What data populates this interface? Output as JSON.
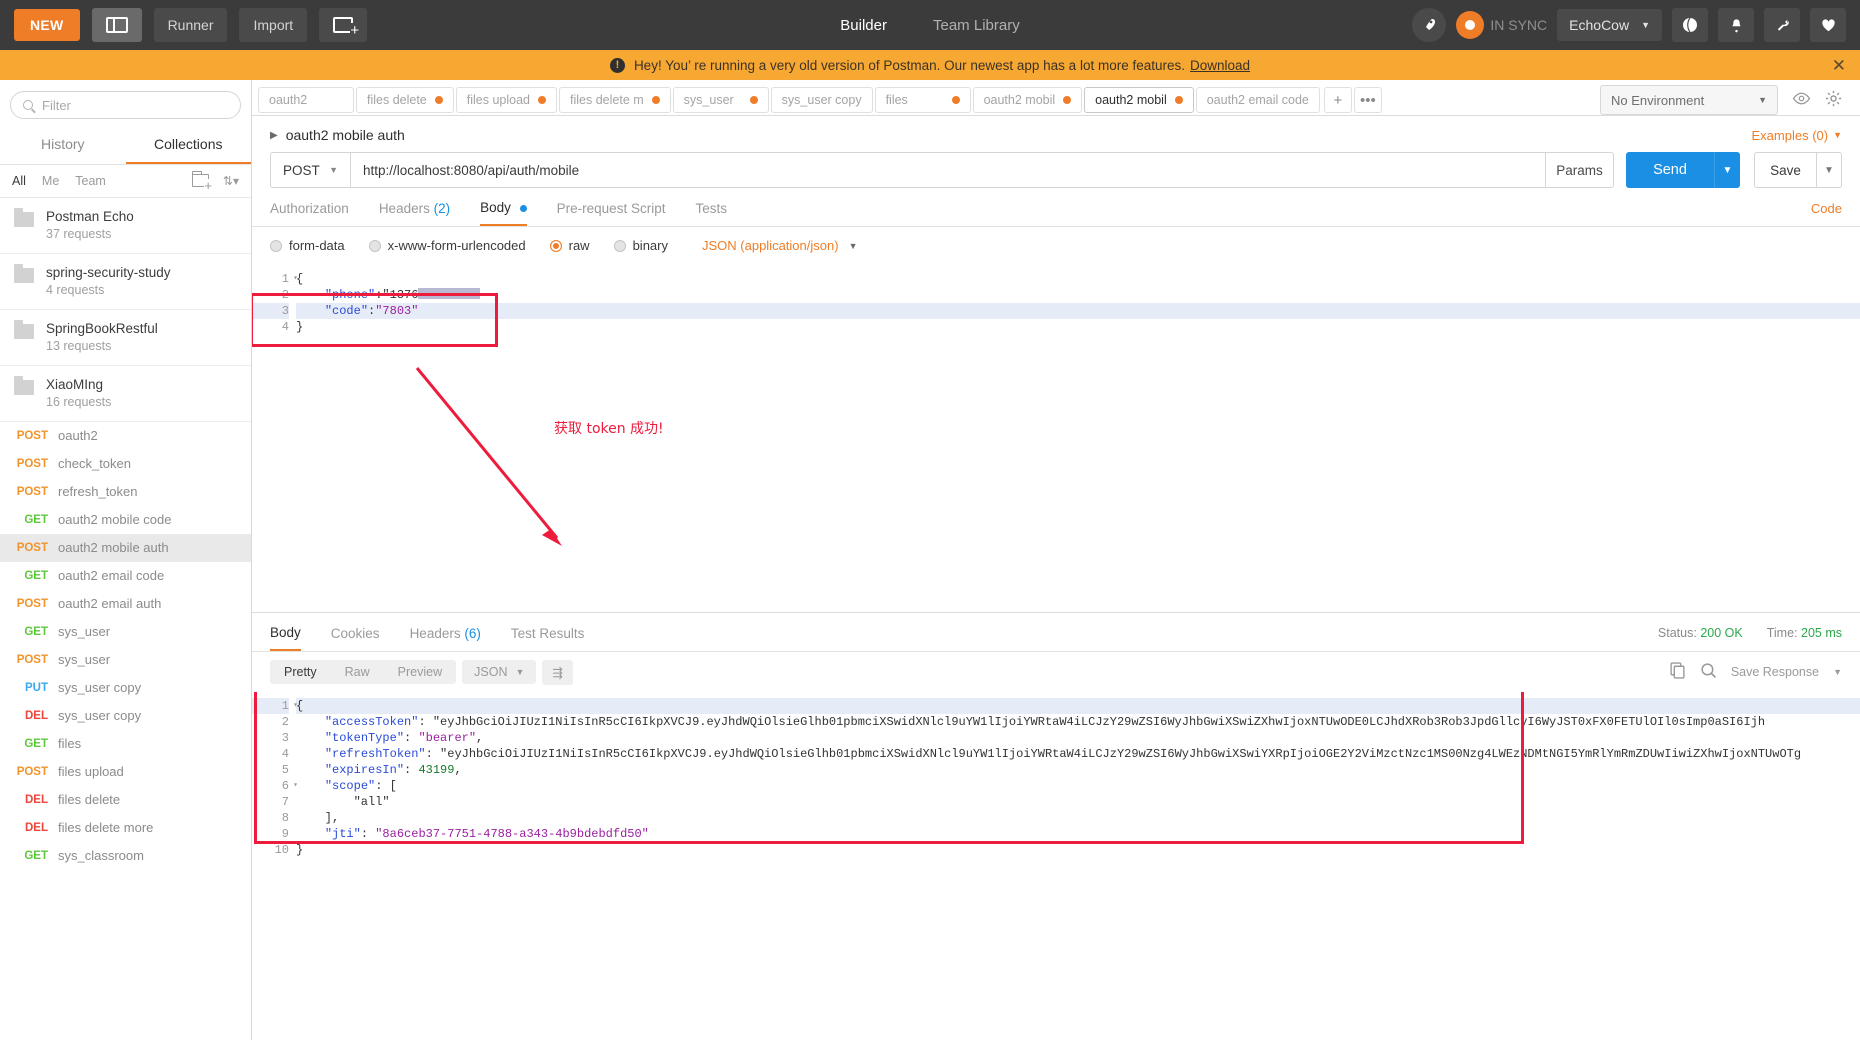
{
  "topbar": {
    "new_label": "NEW",
    "panel_icon": "sidebar-toggle-icon",
    "runner_label": "Runner",
    "import_label": "Import",
    "newtab_icon": "new-tab-icon",
    "nav": [
      {
        "label": "Builder",
        "active": true
      },
      {
        "label": "Team Library",
        "active": false
      }
    ],
    "sync_label": "IN SYNC",
    "user_label": "EchoCow",
    "icons": [
      "rocket-icon",
      "sync-icon",
      "globe-icon",
      "bell-icon",
      "wrench-icon",
      "heart-icon"
    ]
  },
  "banner": {
    "icon": "alert-icon",
    "text": "Hey! You’ re running a very old version of Postman. Our newest app has a lot more features.",
    "link": "Download",
    "close_icon": "close-icon"
  },
  "sidebar": {
    "filter_placeholder": "Filter",
    "search_icon": "search-icon",
    "tabs": [
      {
        "label": "History",
        "active": false
      },
      {
        "label": "Collections",
        "active": true
      }
    ],
    "scopes": [
      {
        "label": "All",
        "selected": true
      },
      {
        "label": "Me",
        "selected": false
      },
      {
        "label": "Team",
        "selected": false
      }
    ],
    "new_folder_icon": "new-folder-icon",
    "sort_icon": "sort-icon",
    "collections": [
      {
        "name": "Postman Echo",
        "count": "37 requests"
      },
      {
        "name": "spring-security-study",
        "count": "4 requests"
      },
      {
        "name": "SpringBookRestful",
        "count": "13 requests"
      },
      {
        "name": "XiaoMIng",
        "count": "16 requests"
      }
    ],
    "requests": [
      {
        "method": "POST",
        "name": "oauth2",
        "selected": false
      },
      {
        "method": "POST",
        "name": "check_token",
        "selected": false
      },
      {
        "method": "POST",
        "name": "refresh_token",
        "selected": false
      },
      {
        "method": "GET",
        "name": "oauth2 mobile code",
        "selected": false
      },
      {
        "method": "POST",
        "name": "oauth2 mobile auth",
        "selected": true
      },
      {
        "method": "GET",
        "name": "oauth2 email code",
        "selected": false
      },
      {
        "method": "POST",
        "name": "oauth2 email auth",
        "selected": false
      },
      {
        "method": "GET",
        "name": "sys_user",
        "selected": false
      },
      {
        "method": "POST",
        "name": "sys_user",
        "selected": false
      },
      {
        "method": "PUT",
        "name": "sys_user copy",
        "selected": false
      },
      {
        "method": "DEL",
        "name": "sys_user copy",
        "selected": false
      },
      {
        "method": "GET",
        "name": "files",
        "selected": false
      },
      {
        "method": "POST",
        "name": "files upload",
        "selected": false
      },
      {
        "method": "DEL",
        "name": "files delete",
        "selected": false
      },
      {
        "method": "DEL",
        "name": "files delete more",
        "selected": false
      },
      {
        "method": "GET",
        "name": "sys_classroom",
        "selected": false
      }
    ]
  },
  "tabstrip": {
    "tabs": [
      {
        "label": "oauth2",
        "unsaved": false,
        "active": false
      },
      {
        "label": "files delete",
        "unsaved": true,
        "active": false
      },
      {
        "label": "files upload",
        "unsaved": true,
        "active": false
      },
      {
        "label": "files delete m",
        "unsaved": true,
        "active": false
      },
      {
        "label": "sys_user",
        "unsaved": true,
        "active": false
      },
      {
        "label": "sys_user copy",
        "unsaved": false,
        "active": false
      },
      {
        "label": "files",
        "unsaved": true,
        "active": false
      },
      {
        "label": "oauth2 mobil",
        "unsaved": true,
        "active": false
      },
      {
        "label": "oauth2 mobil",
        "unsaved": true,
        "active": true
      },
      {
        "label": "oauth2 email code",
        "unsaved": false,
        "active": false
      }
    ],
    "add_label": "+",
    "more_label": "•••",
    "environment": "No Environment",
    "eye_icon": "eye-icon",
    "gear_icon": "gear-icon"
  },
  "request": {
    "title": "oauth2 mobile auth",
    "caret_icon": "chevron-right-icon",
    "examples_label": "Examples (0)",
    "method": "POST",
    "url": "http://localhost:8080/api/auth/mobile",
    "params_label": "Params",
    "send_label": "Send",
    "save_label": "Save",
    "tabs": [
      {
        "label": "Authorization",
        "active": false
      },
      {
        "label": "Headers",
        "count": "(2)",
        "active": false
      },
      {
        "label": "Body",
        "dot": true,
        "active": true
      },
      {
        "label": "Pre-request Script",
        "active": false
      },
      {
        "label": "Tests",
        "active": false
      }
    ],
    "code_label": "Code",
    "body_types": [
      {
        "label": "form-data",
        "selected": false
      },
      {
        "label": "x-www-form-urlencoded",
        "selected": false
      },
      {
        "label": "raw",
        "selected": true
      },
      {
        "label": "binary",
        "selected": false
      }
    ],
    "content_type": "JSON (application/json)",
    "body_lines": [
      {
        "n": "1",
        "fold": true,
        "text": "{"
      },
      {
        "n": "2",
        "fold": false,
        "text": "    \"phone\":\"1376"
      },
      {
        "n": "3",
        "fold": false,
        "text": "    \"code\":\"7803\"",
        "selected": true
      },
      {
        "n": "4",
        "fold": false,
        "text": "}"
      }
    ],
    "annotation": "获取 token 成功!"
  },
  "response": {
    "tabs": [
      {
        "label": "Body",
        "active": true
      },
      {
        "label": "Cookies",
        "active": false
      },
      {
        "label": "Headers",
        "count": "(6)",
        "active": false
      },
      {
        "label": "Test Results",
        "active": false
      }
    ],
    "status_label": "Status:",
    "status_value": "200 OK",
    "time_label": "Time:",
    "time_value": "205 ms",
    "view_modes": [
      {
        "label": "Pretty",
        "active": true
      },
      {
        "label": "Raw",
        "active": false
      },
      {
        "label": "Preview",
        "active": false
      }
    ],
    "format": "JSON",
    "wrap_icon": "word-wrap-icon",
    "copy_icon": "copy-icon",
    "search_icon": "search-icon",
    "save_response_label": "Save Response",
    "body_lines": [
      {
        "n": "1",
        "fold": true,
        "text": "{",
        "selected": true
      },
      {
        "n": "2",
        "fold": false,
        "text": "    \"accessToken\": \"eyJhbGciOiJIUzI1NiIsInR5cCI6IkpXVCJ9.eyJhdWQiOlsieGlhb01pbmciXSwidXNlcl9uYW1lIjoiYWRtaW4iLCJzY29wZSI6WyJhbGwiXSwiZXhwIjoxNTUwODE0LCJhdXRob3Rob3JpdGllcyI6WyJST0xFX0FETUlOIl0sImp0aSI6Ijh"
      },
      {
        "n": "3",
        "fold": false,
        "text": "    \"tokenType\": \"bearer\","
      },
      {
        "n": "4",
        "fold": false,
        "text": "    \"refreshToken\": \"eyJhbGciOiJIUzI1NiIsInR5cCI6IkpXVCJ9.eyJhdWQiOlsieGlhb01pbmciXSwidXNlcl9uYW1lIjoiYWRtaW4iLCJzY29wZSI6WyJhbGwiXSwiYXRpIjoiOGE2Y2ViMzctNzc1MS00Nzg4LWEzNDMtNGI5YmRlYmRmZDUwIiwiZXhwIjoxNTUwOTg"
      },
      {
        "n": "5",
        "fold": false,
        "text": "    \"expiresIn\": 43199,"
      },
      {
        "n": "6",
        "fold": true,
        "text": "    \"scope\": ["
      },
      {
        "n": "7",
        "fold": false,
        "text": "        \"all\""
      },
      {
        "n": "8",
        "fold": false,
        "text": "    ],"
      },
      {
        "n": "9",
        "fold": false,
        "text": "    \"jti\": \"8a6ceb37-7751-4788-a343-4b9bdebdfd50\""
      },
      {
        "n": "10",
        "fold": false,
        "text": "}"
      }
    ]
  },
  "colors": {
    "accent": "#ef7d28",
    "send": "#1a8fe3",
    "annotation": "#ee1c3c",
    "status_ok": "#2aa84a"
  }
}
